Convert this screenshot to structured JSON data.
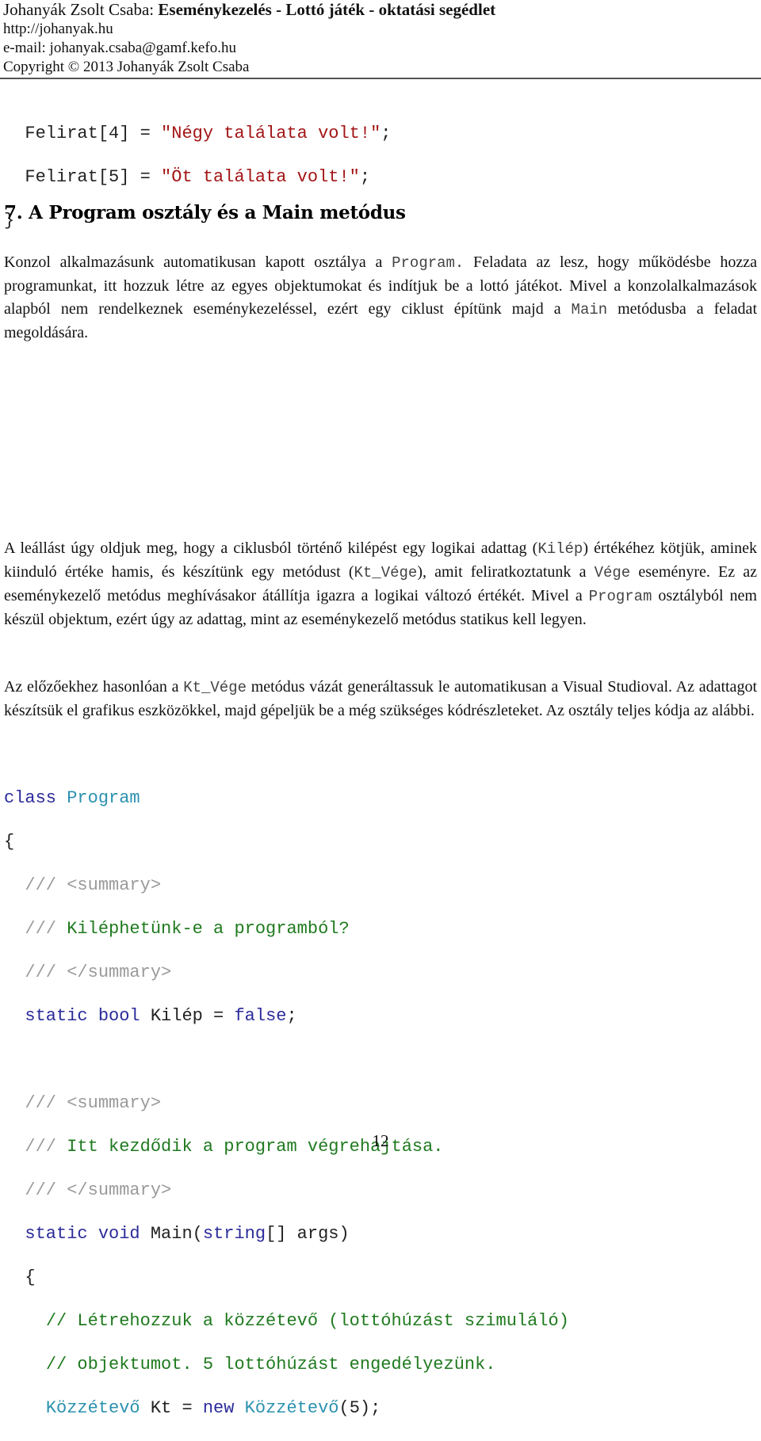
{
  "header": {
    "author_prefix": "Johanyák Zsolt Csaba: ",
    "title": "Eseménykezelés - Lottó játék - oktatási segédlet",
    "website": "http://johanyak.hu",
    "email": "e-mail: johanyak.csaba@gamf.kefo.hu",
    "copyright": "Copyright © 2013 Johanyák Zsolt Csaba"
  },
  "code_top": {
    "lines": [
      {
        "indent": "  ",
        "lhs": "Felirat[4] = ",
        "str": "\"Négy találata volt!\"",
        "end": ";"
      },
      {
        "indent": "  ",
        "lhs": "Felirat[5] = ",
        "str": "\"Öt találata volt!\"",
        "end": ";"
      }
    ],
    "closing_brace": "}"
  },
  "section": {
    "heading": "7. A Program osztály és a Main metódus"
  },
  "paragraph1": {
    "t1": "Konzol alkalmazásunk automatikusan kapott osztálya a ",
    "code1": "Program.",
    "t2": " Feladata az lesz, hogy működésbe hozza programunkat, itt hozzuk létre az egyes objektumokat és indítjuk be a lottó játékot. Mivel a konzolalkalmazások alapból nem rendelkeznek eseménykezeléssel, ezért egy ciklust építünk majd a ",
    "code2": "Main",
    "t3": " metódusba a feladat megoldására."
  },
  "paragraph2": {
    "t1": "A leállást úgy oldjuk meg, hogy a ciklusból történő kilépést egy logikai adattag (",
    "code1": "Kilép",
    "t2": ") értékéhez kötjük, aminek kiinduló értéke hamis, és készítünk egy metódust (",
    "code2": "Kt_Vége",
    "t3": "), amit feliratkoztatunk a ",
    "code3": "Vége",
    "t4": " eseményre. Ez az eseménykezelő metódus meghívásakor átállítja igazra a logikai változó értékét. Mivel a ",
    "code4": "Program",
    "t5": " osztályból nem készül objektum, ezért úgy az adattag, mint az eseménykezelő metódus statikus kell legyen."
  },
  "paragraph3": {
    "t1": "Az előzőekhez hasonlóan a ",
    "code1": "Kt_Vége",
    "t2": " metódus vázát generáltassuk le automatikusan a Visual Studioval. Az adattagot készítsük el grafikus eszközökkel, majd gépeljük be a még szükséges kódrészleteket. Az osztály teljes kódja az alábbi."
  },
  "code_main": {
    "class_kw": "class",
    "class_name": "Program",
    "open_brace": "{",
    "doc1_open": "<summary>",
    "doc1_text": "Kiléphetünk-e a programból?",
    "doc1_close": "</summary>",
    "doc_prefix": "/// ",
    "field_static": "static",
    "field_type": "bool",
    "field_rest": " Kilép = ",
    "field_value": "false",
    "field_end": ";",
    "doc2_open": "<summary>",
    "doc2_text": "Itt kezdődik a program végrehajtása.",
    "doc2_close": "</summary>",
    "main_static": "static",
    "main_void": "void",
    "main_name": " Main(",
    "main_param_type": "string",
    "main_param_rest": "[] args)",
    "main_open_brace": "{",
    "comment1": "// Létrehozzuk a közzétevő (lottóhúzást szimuláló)",
    "comment2": "// objektumot. 5 lottóhúzást engedélyezünk.",
    "decl_type": "Közzétevő",
    "decl_var": " Kt = ",
    "decl_new": "new",
    "decl_ctor": "Közzétevő",
    "decl_args": "(5);"
  },
  "footer": {
    "page_number": "12"
  }
}
